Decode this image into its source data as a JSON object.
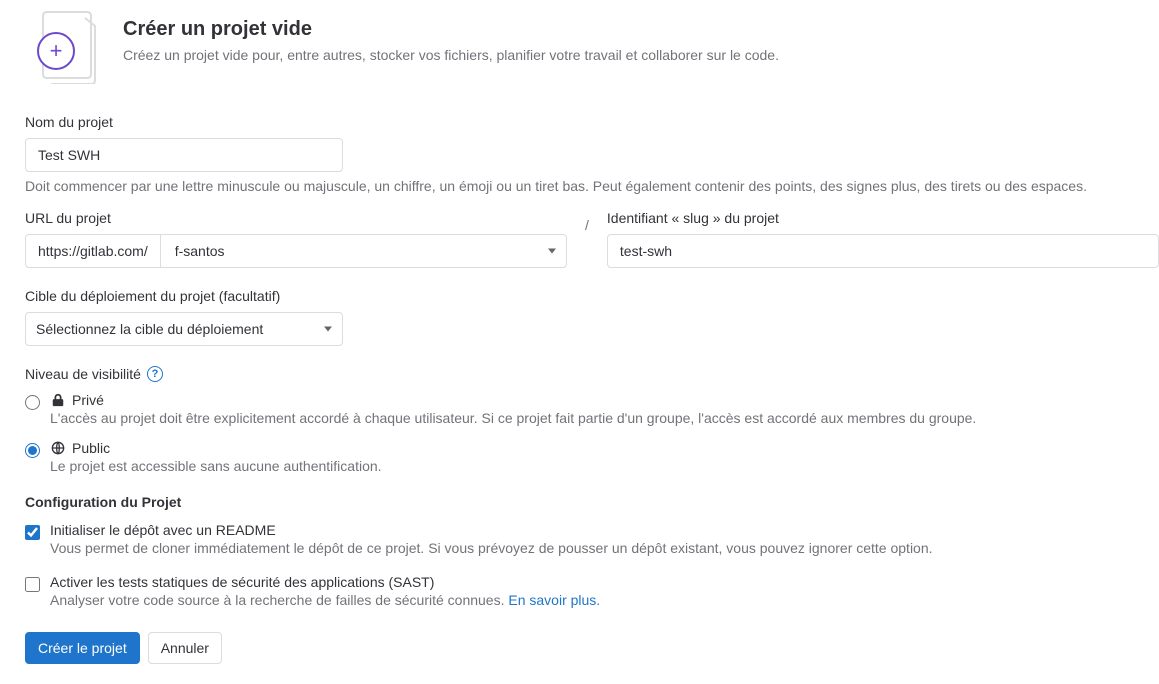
{
  "header": {
    "title": "Créer un projet vide",
    "subtitle": "Créez un projet vide pour, entre autres, stocker vos fichiers, planifier votre travail et collaborer sur le code."
  },
  "project_name": {
    "label": "Nom du projet",
    "value": "Test SWH",
    "helper": "Doit commencer par une lettre minuscule ou majuscule, un chiffre, un émoji ou un tiret bas. Peut également contenir des points, des signes plus, des tirets ou des espaces."
  },
  "project_url": {
    "label": "URL du projet",
    "base": "https://gitlab.com/",
    "namespace": "f-santos"
  },
  "slug": {
    "label": "Identifiant « slug » du projet",
    "value": "test-swh"
  },
  "deploy": {
    "label": "Cible du déploiement du projet (facultatif)",
    "placeholder": "Sélectionnez la cible du déploiement"
  },
  "visibility": {
    "label": "Niveau de visibilité",
    "private_label": "Privé",
    "private_desc": "L'accès au projet doit être explicitement accordé à chaque utilisateur. Si ce projet fait partie d'un groupe, l'accès est accordé aux membres du groupe.",
    "public_label": "Public",
    "public_desc": "Le projet est accessible sans aucune authentification."
  },
  "config": {
    "title": "Configuration du Projet",
    "readme_label": "Initialiser le dépôt avec un README",
    "readme_desc": "Vous permet de cloner immédiatement le dépôt de ce projet. Si vous prévoyez de pousser un dépôt existant, vous pouvez ignorer cette option.",
    "sast_label": "Activer les tests statiques de sécurité des applications (SAST)",
    "sast_desc": "Analyser votre code source à la recherche de failles de sécurité connues. ",
    "sast_link": "En savoir plus."
  },
  "buttons": {
    "create": "Créer le projet",
    "cancel": "Annuler"
  }
}
